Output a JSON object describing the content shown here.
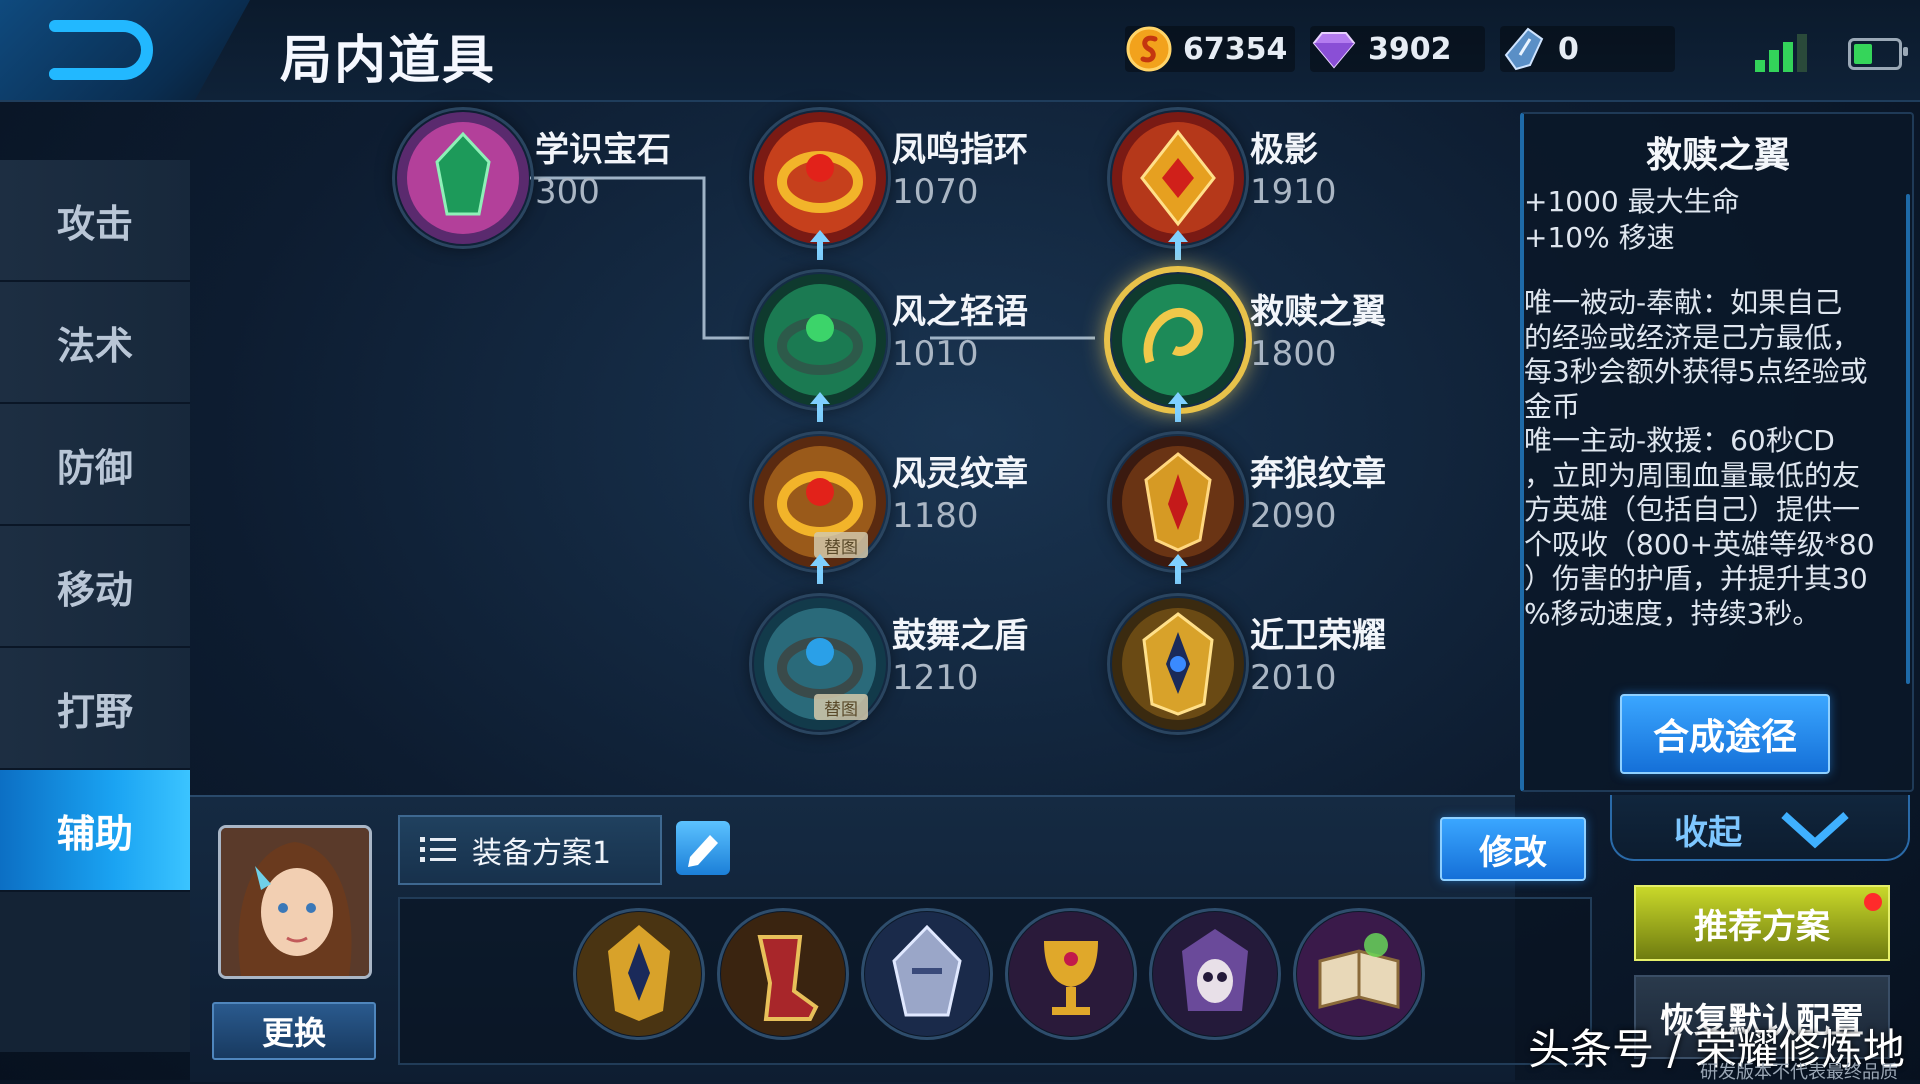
{
  "header": {
    "title": "局内道具"
  },
  "currency": {
    "gold": "67354",
    "diamond": "3902",
    "ticket": "0"
  },
  "sidebar": {
    "items": [
      {
        "label": "攻击"
      },
      {
        "label": "法术"
      },
      {
        "label": "防御"
      },
      {
        "label": "移动"
      },
      {
        "label": "打野"
      },
      {
        "label": "辅助",
        "active": true
      }
    ]
  },
  "tree": {
    "items": [
      {
        "name": "学识宝石",
        "price": "300",
        "icon": "green-gem-icon"
      },
      {
        "name": "凤鸣指环",
        "price": "1070",
        "icon": "phoenix-ring-icon"
      },
      {
        "name": "极影",
        "price": "1910",
        "icon": "shadow-amulet-icon"
      },
      {
        "name": "风之轻语",
        "price": "1010",
        "icon": "wind-whisper-icon"
      },
      {
        "name": "救赎之翼",
        "price": "1800",
        "icon": "redemption-wing-icon",
        "selected": true
      },
      {
        "name": "风灵纹章",
        "price": "1180",
        "icon": "wind-emblem-icon",
        "badge": "替图"
      },
      {
        "name": "奔狼纹章",
        "price": "2090",
        "icon": "wolf-emblem-icon"
      },
      {
        "name": "鼓舞之盾",
        "price": "1210",
        "icon": "inspire-shield-icon",
        "badge": "替图"
      },
      {
        "name": "近卫荣耀",
        "price": "2010",
        "icon": "guard-glory-icon"
      }
    ]
  },
  "detail": {
    "name": "救赎之翼",
    "stat1": "+1000 最大生命",
    "stat2": "+10% 移速",
    "desc_lines": [
      "唯一被动-奉献：如果自己",
      "的经验或经济是己方最低，",
      "每3秒会额外获得5点经验或",
      "金币",
      "唯一主动-救援：60秒CD",
      "，立即为周围血量最低的友",
      "方英雄（包括自己）提供一",
      "个吸收（800+英雄等级*80",
      "）伤害的护盾，并提升其30",
      "%移动速度，持续3秒。"
    ],
    "synth_button": "合成途径"
  },
  "bottom": {
    "change_button": "更换",
    "plan_name": "装备方案1",
    "modify_button": "修改",
    "collapse_label": "收起",
    "recommend_button": "推荐方案",
    "restore_button": "恢复默认配置",
    "equipped": [
      {
        "icon": "guard-glory-icon"
      },
      {
        "icon": "red-boots-icon"
      },
      {
        "icon": "silver-helm-icon"
      },
      {
        "icon": "golden-chalice-icon"
      },
      {
        "icon": "skull-armor-icon"
      },
      {
        "icon": "spell-book-icon"
      }
    ]
  },
  "watermark": "头条号 / 荣耀修炼地",
  "disclaimer": "研发版本不代表最终品质",
  "colors": {
    "accent": "#1aa3f2",
    "gold_ring": "#e8c24a",
    "recommend": "#c9d82a",
    "signal": "#33d35a"
  }
}
